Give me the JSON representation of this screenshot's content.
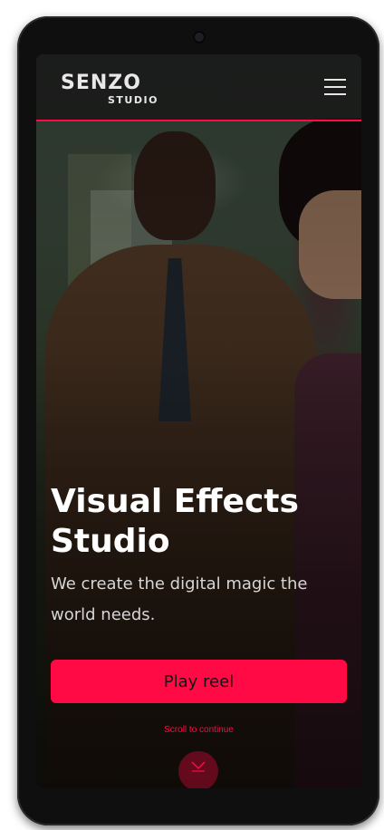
{
  "header": {
    "logo_main": "SENZO",
    "logo_sub": "STUDIO"
  },
  "hero": {
    "title": "Visual Effects Studio",
    "subtitle": "We create the digital magic the world needs.",
    "play_label": "Play reel",
    "scroll_hint": "Scroll to continue"
  },
  "colors": {
    "accent": "#ff0a45",
    "header_bg": "#191919"
  },
  "icons": {
    "menu": "hamburger-menu-icon",
    "scroll": "chevron-down-icon"
  }
}
